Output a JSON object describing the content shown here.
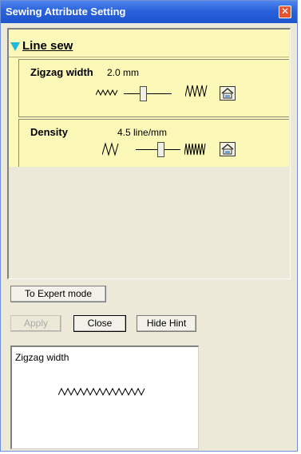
{
  "window": {
    "title": "Sewing Attribute Setting"
  },
  "section": {
    "label": "Line sew"
  },
  "zigzag": {
    "label": "Zigzag width",
    "value": "2.0 mm",
    "slider_fraction": 0.4
  },
  "density": {
    "label": "Density",
    "value": "4.5 line/mm",
    "slider_fraction": 0.55
  },
  "buttons": {
    "expert": "To Expert mode",
    "apply": "Apply",
    "close": "Close",
    "hide_hint": "Hide Hint"
  },
  "hint": {
    "title": "Zigzag width"
  },
  "icons": {
    "close": "close-icon",
    "collapse": "triangle-down-icon",
    "reset": "reset-default-icon"
  }
}
